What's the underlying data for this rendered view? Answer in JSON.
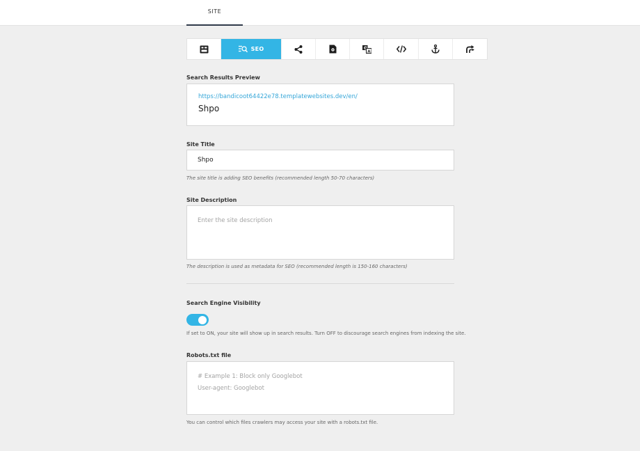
{
  "header": {
    "tab_site": "SITE"
  },
  "toolbar": {
    "seo_label": "SEO",
    "items": [
      "layout-icon",
      "seo-search-icon",
      "share-icon",
      "page-settings-icon",
      "translate-icon",
      "code-icon",
      "anchor-icon",
      "redirect-icon"
    ],
    "accent_color": "#33b5e5"
  },
  "preview": {
    "label": "Search Results Preview",
    "url": "https://bandicoot64422e78.templatewebsites.dev/en/",
    "title": "Shpo"
  },
  "site_title": {
    "label": "Site Title",
    "value": "Shpo",
    "help": "The site title is adding SEO benefits (recommended length 50-70 characters)"
  },
  "site_description": {
    "label": "Site Description",
    "placeholder": "Enter the site description",
    "help": "The description is used as metadata for SEO (recommended length is 150-160 characters)"
  },
  "visibility": {
    "label": "Search Engine Visibility",
    "state": "on",
    "help": "If set to ON, your site will show up in search results. Turn OFF to discourage search engines from indexing the site."
  },
  "robots": {
    "label": "Robots.txt file",
    "placeholder_line1": "# Example 1: Block only Googlebot",
    "placeholder_line2": "User-agent: Googlebot",
    "help": "You can control which files crawlers may access your site with a robots.txt file."
  }
}
